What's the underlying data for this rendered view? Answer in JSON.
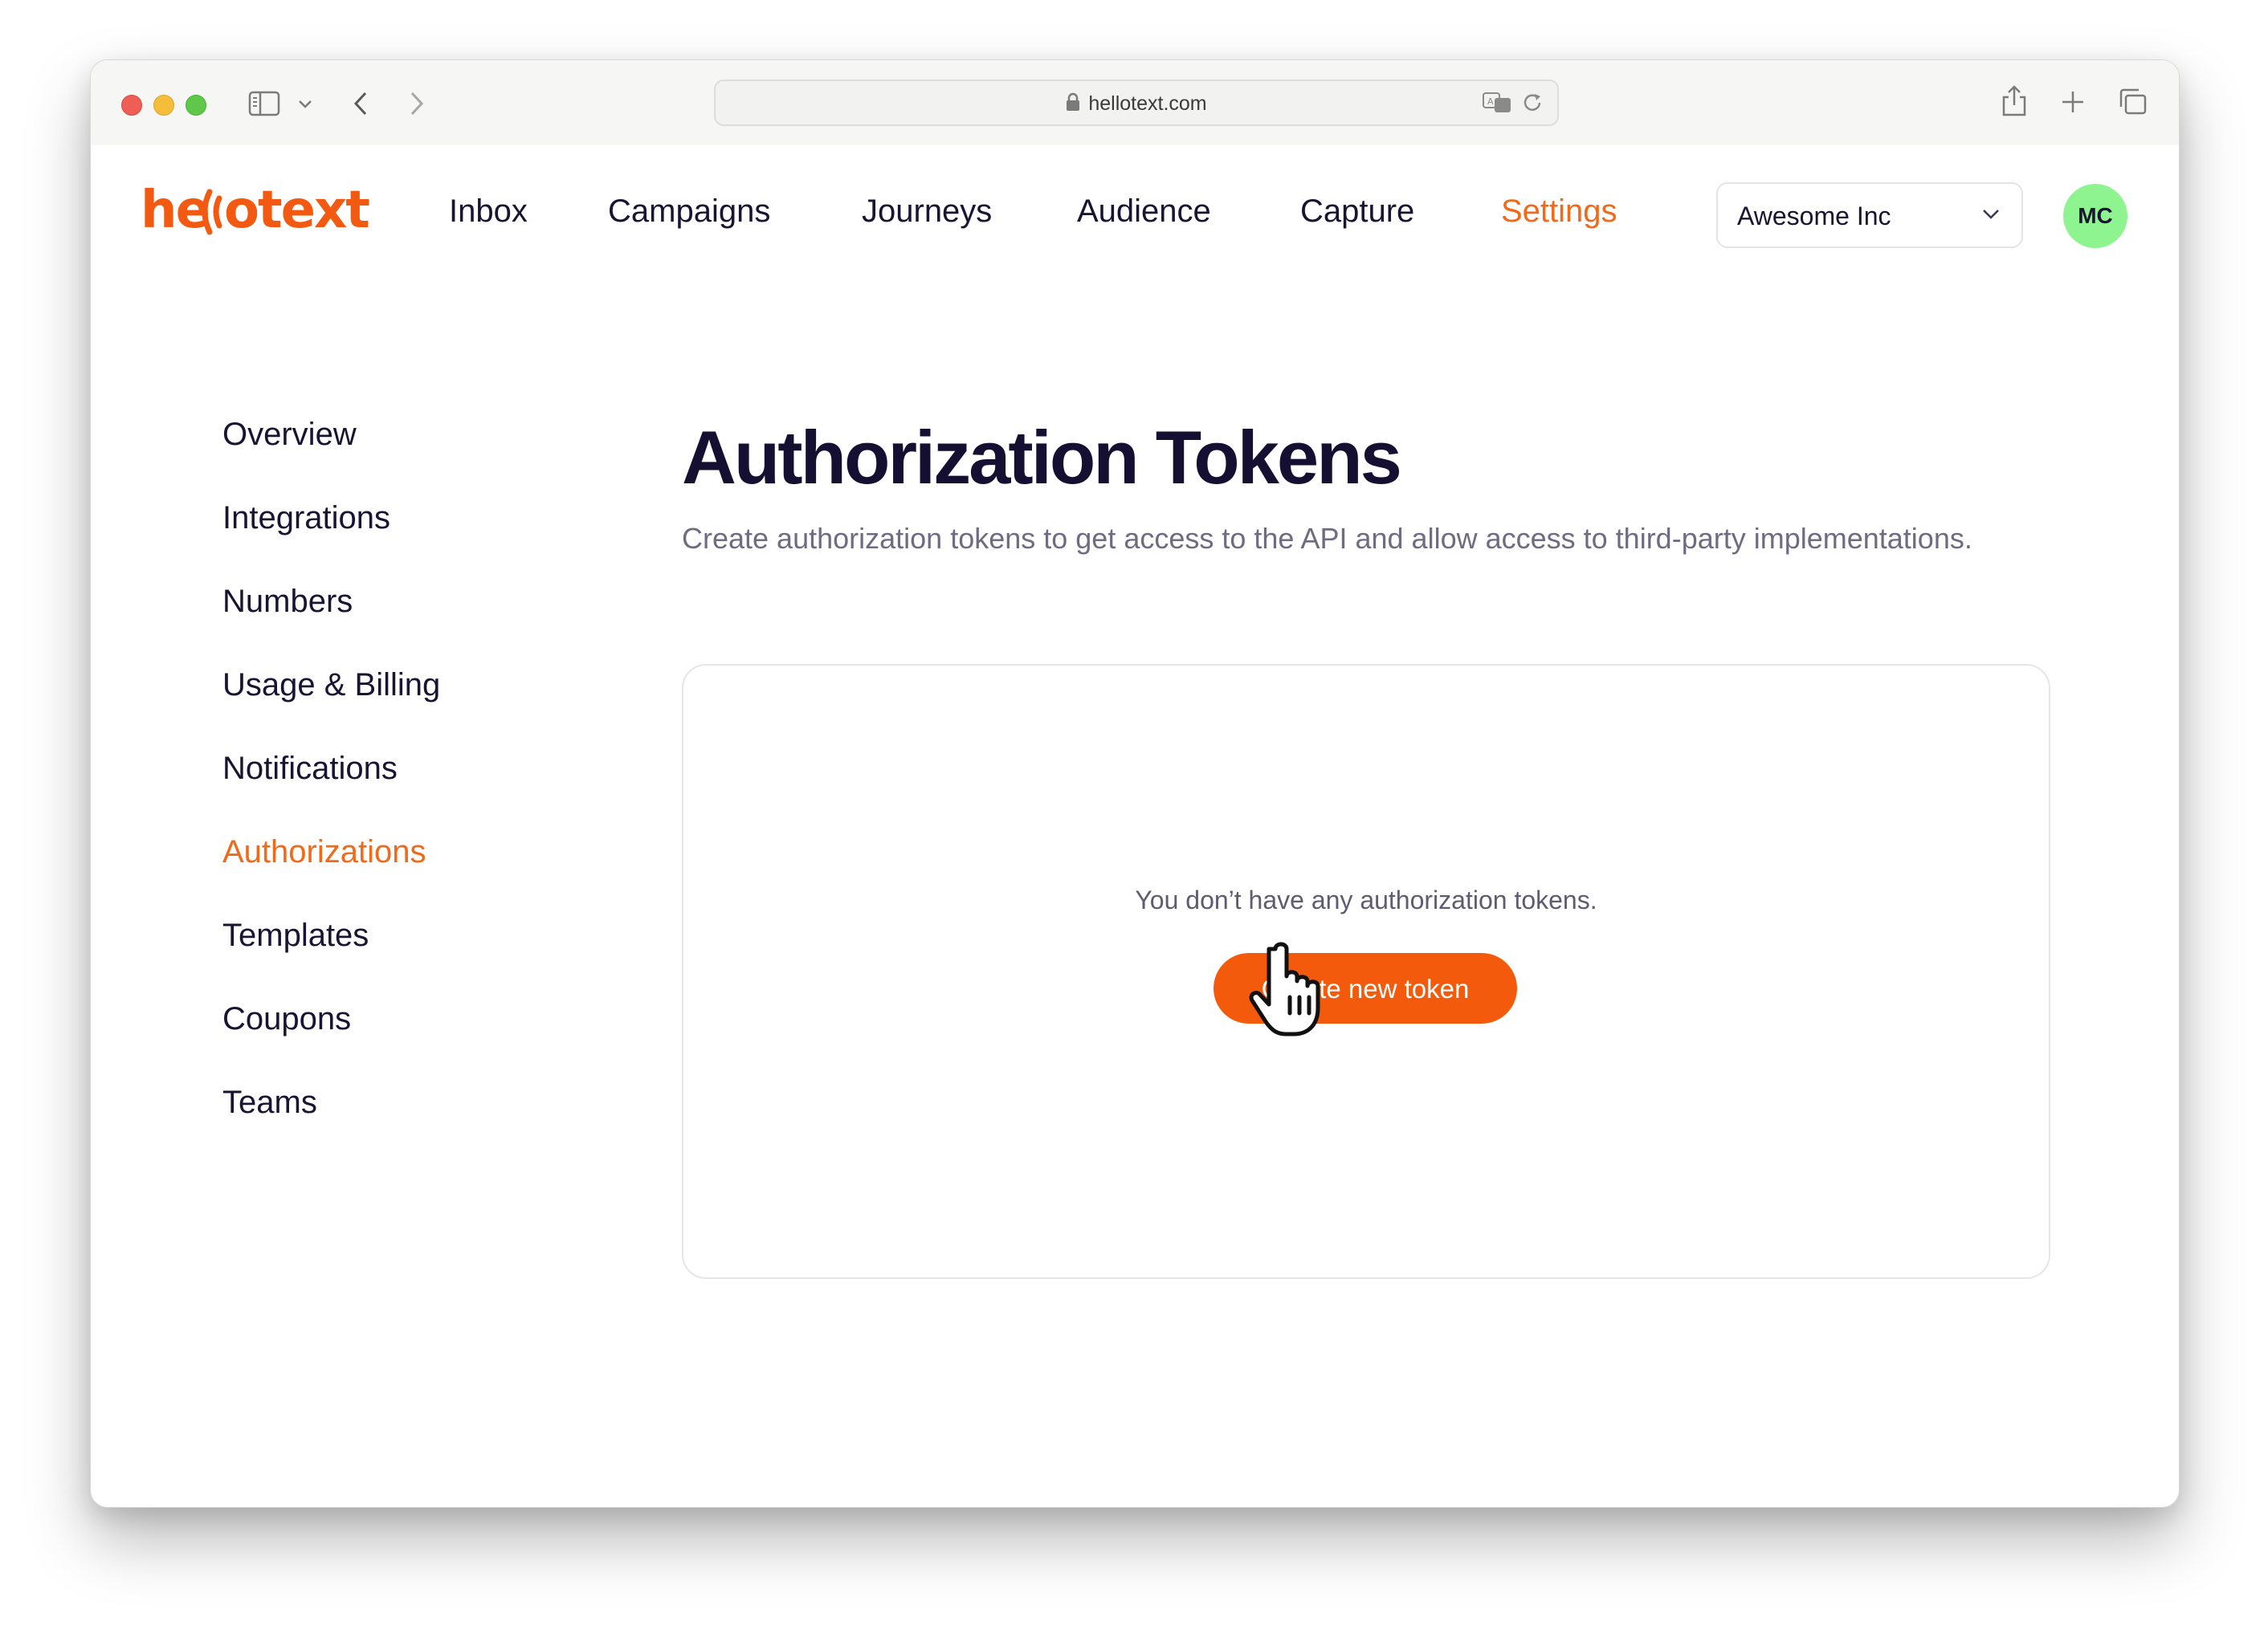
{
  "browser": {
    "url": "hellotext.com",
    "icons": {
      "sidebar_toggle": "sidebar-icon",
      "dropdown": "chevron-down-icon",
      "back": "chevron-left-icon",
      "forward": "chevron-right-icon",
      "lock": "lock-icon",
      "translate": "translate-icon",
      "reload": "reload-icon",
      "share": "share-icon",
      "new_tab": "plus-icon",
      "tabs": "tabs-icon"
    }
  },
  "app": {
    "logo_text": "hellotext",
    "brand_color": "#f35a11",
    "nav": [
      {
        "label": "Inbox",
        "active": false
      },
      {
        "label": "Campaigns",
        "active": false
      },
      {
        "label": "Journeys",
        "active": false
      },
      {
        "label": "Audience",
        "active": false
      },
      {
        "label": "Capture",
        "active": false
      },
      {
        "label": "Settings",
        "active": true
      }
    ],
    "org_select": {
      "value": "Awesome Inc"
    },
    "avatar": {
      "initials": "MC",
      "color": "#8ef48f"
    }
  },
  "sidebar": {
    "items": [
      {
        "label": "Overview",
        "active": false
      },
      {
        "label": "Integrations",
        "active": false
      },
      {
        "label": "Numbers",
        "active": false
      },
      {
        "label": "Usage & Billing",
        "active": false
      },
      {
        "label": "Notifications",
        "active": false
      },
      {
        "label": "Authorizations",
        "active": true
      },
      {
        "label": "Templates",
        "active": false
      },
      {
        "label": "Coupons",
        "active": false
      },
      {
        "label": "Teams",
        "active": false
      }
    ]
  },
  "main": {
    "title": "Authorization Tokens",
    "description": "Create authorization tokens to get access to the API and allow access to third-party implementations.",
    "empty_state": {
      "message": "You don’t have any authorization tokens.",
      "button_label": "Create new token"
    }
  }
}
